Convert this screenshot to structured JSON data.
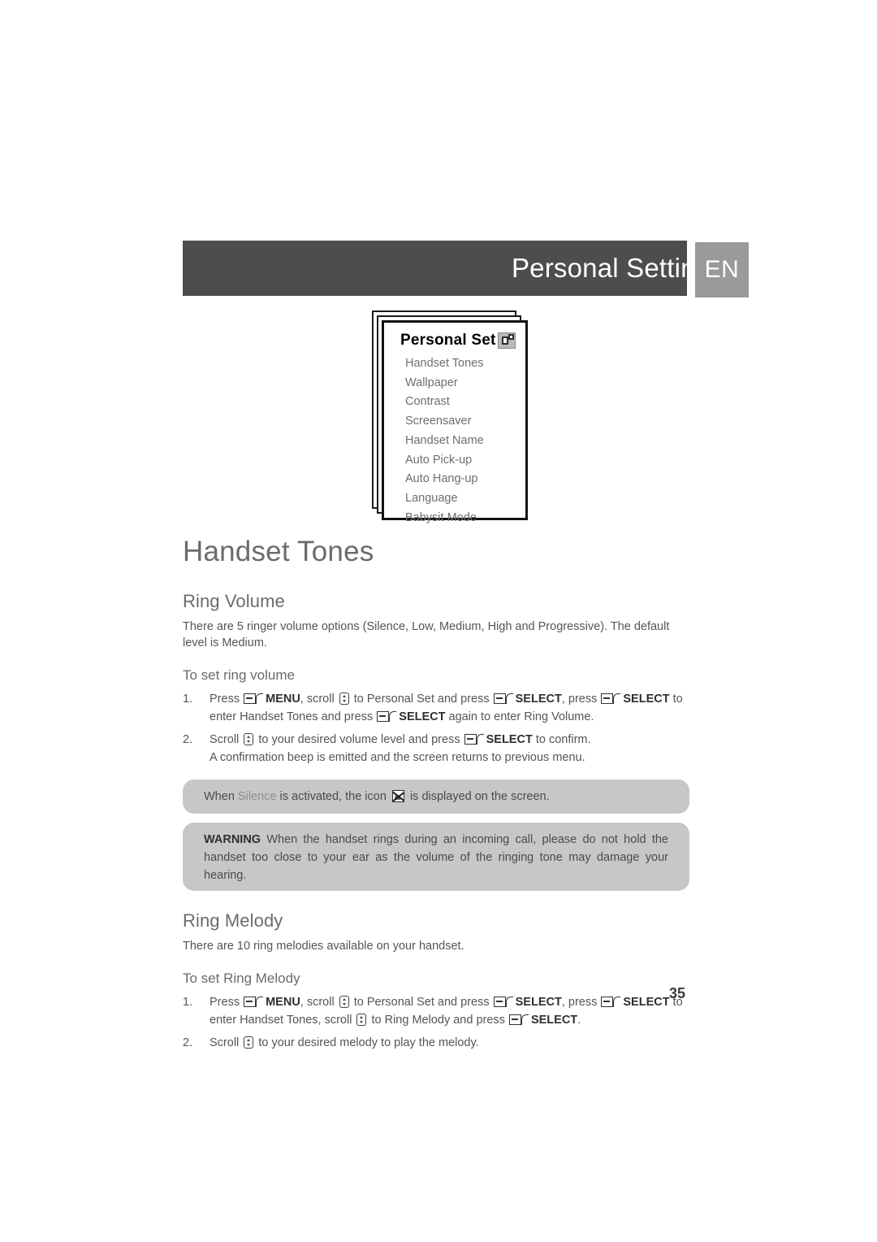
{
  "header": {
    "title": "Personal Settings",
    "language_badge": "EN"
  },
  "menu_figure": {
    "title": "Personal Set",
    "icon": "settings-icon",
    "items": [
      "Handset Tones",
      "Wallpaper",
      "Contrast",
      "Screensaver",
      "Handset Name",
      "Auto Pick-up",
      "Auto Hang-up",
      "Language",
      "Babysit Mode"
    ]
  },
  "content": {
    "section_title": "Handset Tones",
    "ring_volume": {
      "heading": "Ring Volume",
      "lead": "There are 5 ringer volume options (Silence, Low, Medium, High and Progressive). The default level is Medium.",
      "procedure_title": "To set ring volume",
      "steps": [
        {
          "number": "1.",
          "parts": [
            {
              "t": "text",
              "v": "Press "
            },
            {
              "t": "softkey"
            },
            {
              "t": "bold",
              "v": "MENU"
            },
            {
              "t": "text",
              "v": ", scroll "
            },
            {
              "t": "scrollkey"
            },
            {
              "t": "text",
              "v": " to Personal Set and press "
            },
            {
              "t": "softkey"
            },
            {
              "t": "bold",
              "v": "SELECT"
            },
            {
              "t": "text",
              "v": ", press "
            },
            {
              "t": "softkey"
            },
            {
              "t": "bold",
              "v": "SELECT"
            },
            {
              "t": "text",
              "v": " to enter Handset Tones and press "
            },
            {
              "t": "softkey"
            },
            {
              "t": "bold",
              "v": "SELECT"
            },
            {
              "t": "text",
              "v": " again to enter Ring Volume."
            }
          ]
        },
        {
          "number": "2.",
          "parts": [
            {
              "t": "text",
              "v": "Scroll "
            },
            {
              "t": "scrollkey"
            },
            {
              "t": "text",
              "v": " to your desired volume level and press "
            },
            {
              "t": "softkey"
            },
            {
              "t": "bold",
              "v": "SELECT"
            },
            {
              "t": "text",
              "v": " to confirm."
            },
            {
              "t": "break"
            },
            {
              "t": "text",
              "v": "A confirmation beep is emitted and the screen returns to previous menu."
            }
          ]
        }
      ],
      "note": {
        "before": "When ",
        "highlight": "Silence",
        "middle": " is activated, the icon ",
        "icon": "silence-icon",
        "after": " is displayed on the screen."
      },
      "warning": {
        "label": "WARNING",
        "text": " When the handset rings during an incoming call, please do not hold the handset too close to your ear as the volume of the ringing tone may damage your hearing."
      }
    },
    "ring_melody": {
      "heading": "Ring Melody",
      "lead": "There are 10 ring melodies available on your handset.",
      "procedure_title": "To set Ring Melody",
      "steps": [
        {
          "number": "1.",
          "parts": [
            {
              "t": "text",
              "v": "Press "
            },
            {
              "t": "softkey"
            },
            {
              "t": "bold",
              "v": "MENU"
            },
            {
              "t": "text",
              "v": ", scroll "
            },
            {
              "t": "scrollkey"
            },
            {
              "t": "text",
              "v": " to Personal Set and press "
            },
            {
              "t": "softkey"
            },
            {
              "t": "bold",
              "v": "SELECT"
            },
            {
              "t": "text",
              "v": ", press "
            },
            {
              "t": "softkey"
            },
            {
              "t": "bold",
              "v": "SELECT"
            },
            {
              "t": "text",
              "v": " to enter Handset Tones, scroll "
            },
            {
              "t": "scrollkey"
            },
            {
              "t": "text",
              "v": " to Ring Melody and press "
            },
            {
              "t": "softkey"
            },
            {
              "t": "bold",
              "v": "SELECT"
            },
            {
              "t": "text",
              "v": "."
            }
          ]
        },
        {
          "number": "2.",
          "parts": [
            {
              "t": "text",
              "v": "Scroll "
            },
            {
              "t": "scrollkey"
            },
            {
              "t": "text",
              "v": " to your desired melody to play the melody."
            }
          ]
        }
      ]
    }
  },
  "footer": {
    "page_number": "35"
  },
  "colors": {
    "header_band": "#4d4d4d",
    "language_badge": "#9a9a9a",
    "callout_background": "#c7c7c7",
    "body_text": "#555555",
    "heading_text": "#6b6b6b"
  }
}
